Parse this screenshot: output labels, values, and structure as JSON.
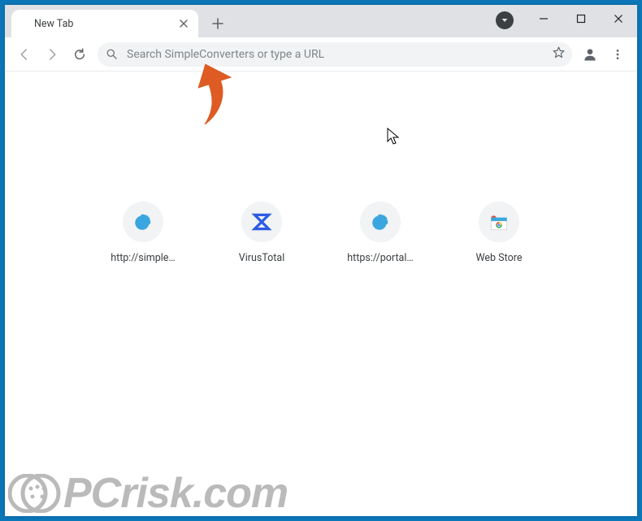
{
  "tab": {
    "title": "New Tab",
    "close_aria": "Close tab"
  },
  "tabstrip": {
    "newtab_aria": "New tab"
  },
  "window_controls": {
    "minimize_aria": "Minimize",
    "maximize_aria": "Maximize",
    "close_aria": "Close"
  },
  "toolbar": {
    "back_aria": "Back",
    "forward_aria": "Forward",
    "reload_aria": "Reload",
    "omnibox_placeholder": "Search SimpleConverters or type a URL",
    "bookmark_aria": "Bookmark this page",
    "profile_aria": "Profile",
    "menu_aria": "Menu"
  },
  "shortcuts": [
    {
      "label": "http://simple…",
      "icon": "edge"
    },
    {
      "label": "VirusTotal",
      "icon": "vt"
    },
    {
      "label": "https://portal…",
      "icon": "edge"
    },
    {
      "label": "Web Store",
      "icon": "webstore"
    }
  ],
  "watermark": {
    "text": "PCrisk.com"
  },
  "colors": {
    "frame": "#0b76b8",
    "tabstrip": "#dfe1e5",
    "omnibox_bg": "#f1f3f4",
    "text_primary": "#3c4043",
    "text_secondary": "#5f6368",
    "annotation_arrow": "#de5b24"
  }
}
